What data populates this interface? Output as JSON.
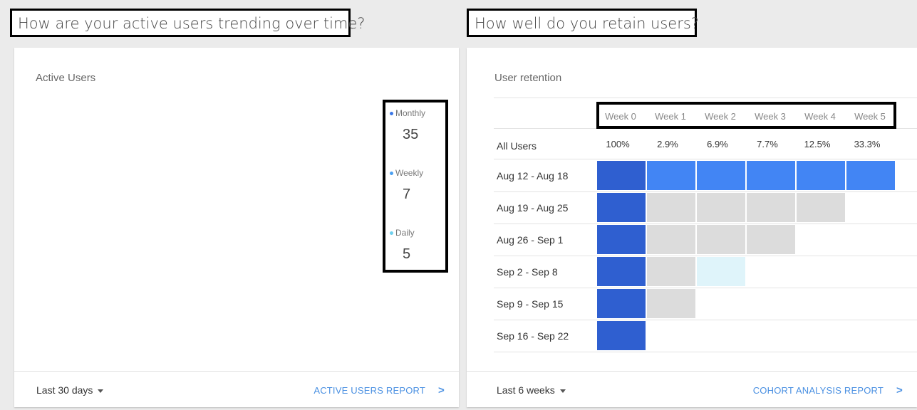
{
  "left": {
    "heading": "How are your active users trending over time?",
    "title": "Active Users",
    "legend": [
      {
        "label": "Monthly",
        "value": "35",
        "color": "#3b78e7"
      },
      {
        "label": "Weekly",
        "value": "7",
        "color": "#4a9ff0"
      },
      {
        "label": "Daily",
        "value": "5",
        "color": "#6fd0ee"
      }
    ],
    "range": "Last 30 days",
    "report": "ACTIVE USERS REPORT"
  },
  "right": {
    "heading": "How well do you retain users?",
    "title": "User retention",
    "weeks": [
      "Week 0",
      "Week 1",
      "Week 2",
      "Week 3",
      "Week 4",
      "Week 5"
    ],
    "all_users": {
      "label": "All Users",
      "values": [
        "100%",
        "2.9%",
        "6.9%",
        "7.7%",
        "12.5%",
        "33.3%"
      ]
    },
    "cohorts": [
      {
        "label": "Aug 12 - Aug 18",
        "cells": [
          "dark",
          "mid",
          "mid",
          "mid",
          "mid",
          "mid"
        ]
      },
      {
        "label": "Aug 19 - Aug 25",
        "cells": [
          "dark",
          "gray",
          "gray",
          "gray",
          "gray"
        ]
      },
      {
        "label": "Aug 26 - Sep 1",
        "cells": [
          "dark",
          "gray",
          "gray",
          "gray"
        ]
      },
      {
        "label": "Sep 2 - Sep 8",
        "cells": [
          "dark",
          "gray",
          "light"
        ]
      },
      {
        "label": "Sep 9 - Sep 15",
        "cells": [
          "dark",
          "gray"
        ]
      },
      {
        "label": "Sep 16 - Sep 22",
        "cells": [
          "dark"
        ]
      }
    ],
    "colors": {
      "dark": "#2f5fd0",
      "mid": "#4285f4",
      "gray": "#dcdcdc",
      "light": "#dff4fa"
    },
    "range": "Last 6 weeks",
    "report": "COHORT ANALYSIS REPORT"
  }
}
